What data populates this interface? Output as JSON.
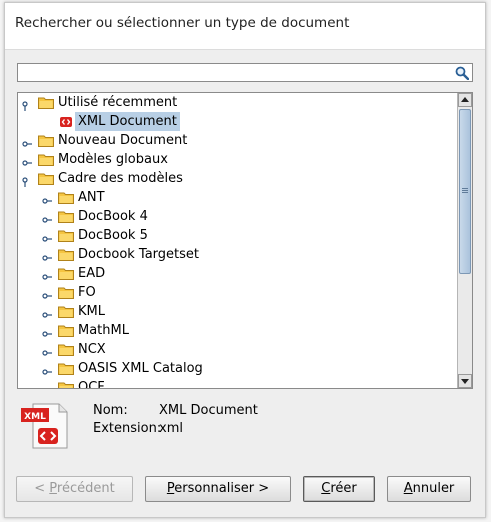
{
  "header": {
    "title": "Rechercher ou sélectionner un type de document"
  },
  "search": {
    "value": "",
    "placeholder": ""
  },
  "tree": [
    {
      "label": "Utilisé récemment",
      "expanded": true,
      "level": 0,
      "type": "folder"
    },
    {
      "label": "XML Document",
      "level": 1,
      "type": "document",
      "selected": true
    },
    {
      "label": "Nouveau Document",
      "expanded": false,
      "level": 0,
      "type": "folder"
    },
    {
      "label": "Modèles globaux",
      "expanded": false,
      "level": 0,
      "type": "folder"
    },
    {
      "label": "Cadre des modèles",
      "expanded": true,
      "level": 0,
      "type": "folder"
    },
    {
      "label": "ANT",
      "expanded": false,
      "level": 1,
      "type": "folder"
    },
    {
      "label": "DocBook 4",
      "expanded": false,
      "level": 1,
      "type": "folder"
    },
    {
      "label": "DocBook 5",
      "expanded": false,
      "level": 1,
      "type": "folder"
    },
    {
      "label": "Docbook Targetset",
      "expanded": false,
      "level": 1,
      "type": "folder"
    },
    {
      "label": "EAD",
      "expanded": false,
      "level": 1,
      "type": "folder"
    },
    {
      "label": "FO",
      "expanded": false,
      "level": 1,
      "type": "folder"
    },
    {
      "label": "KML",
      "expanded": false,
      "level": 1,
      "type": "folder"
    },
    {
      "label": "MathML",
      "expanded": false,
      "level": 1,
      "type": "folder"
    },
    {
      "label": "NCX",
      "expanded": false,
      "level": 1,
      "type": "folder"
    },
    {
      "label": "OASIS XML Catalog",
      "expanded": false,
      "level": 1,
      "type": "folder"
    },
    {
      "label": "OCF",
      "expanded": false,
      "level": 1,
      "type": "folder"
    }
  ],
  "info": {
    "icon_text": "XML",
    "name_key": "Nom:",
    "name_value": "XML Document",
    "ext_key": "Extension:",
    "ext_value": "xml"
  },
  "buttons": {
    "previous": {
      "prefix": "< ",
      "mnemonic": "P",
      "rest": "récédent"
    },
    "customize": {
      "prefix": "",
      "mnemonic": "P",
      "rest": "ersonnaliser >"
    },
    "create": {
      "prefix": "",
      "mnemonic": "C",
      "rest": "réer"
    },
    "cancel": {
      "prefix": "",
      "mnemonic": "A",
      "rest": "nnuler"
    }
  },
  "colors": {
    "selection": "#b8cfe5",
    "doc_icon_red": "#d8231f",
    "folder_yellow": "#f5c542"
  }
}
